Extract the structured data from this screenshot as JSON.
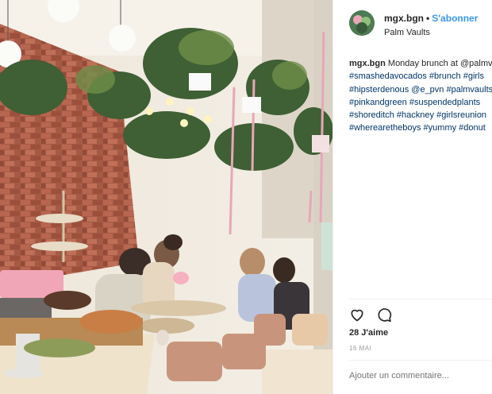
{
  "post": {
    "username": "mgx.bgn",
    "separator": "•",
    "follow_label": "S'abonner",
    "location": "Palm Vaults",
    "caption_lines": [
      "Monday brunch at @palmvaults",
      "#smashedavocados #brunch #girls",
      "#hipsterdenous @e_pvn #palmvaults",
      "#pinkandgreen #suspendedplants",
      "#shoreditch #hackney #girlsreunion",
      "#wherearetheboys #yummy #donut"
    ],
    "likes": "28 J'aime",
    "date": "16 MAI",
    "comment_placeholder": "Ajouter un commentaire..."
  },
  "icons": {
    "like": "heart-icon",
    "comment": "comment-icon"
  },
  "colors": {
    "accent": "#3897f0",
    "hashtag": "#003569",
    "muted": "#999999"
  }
}
